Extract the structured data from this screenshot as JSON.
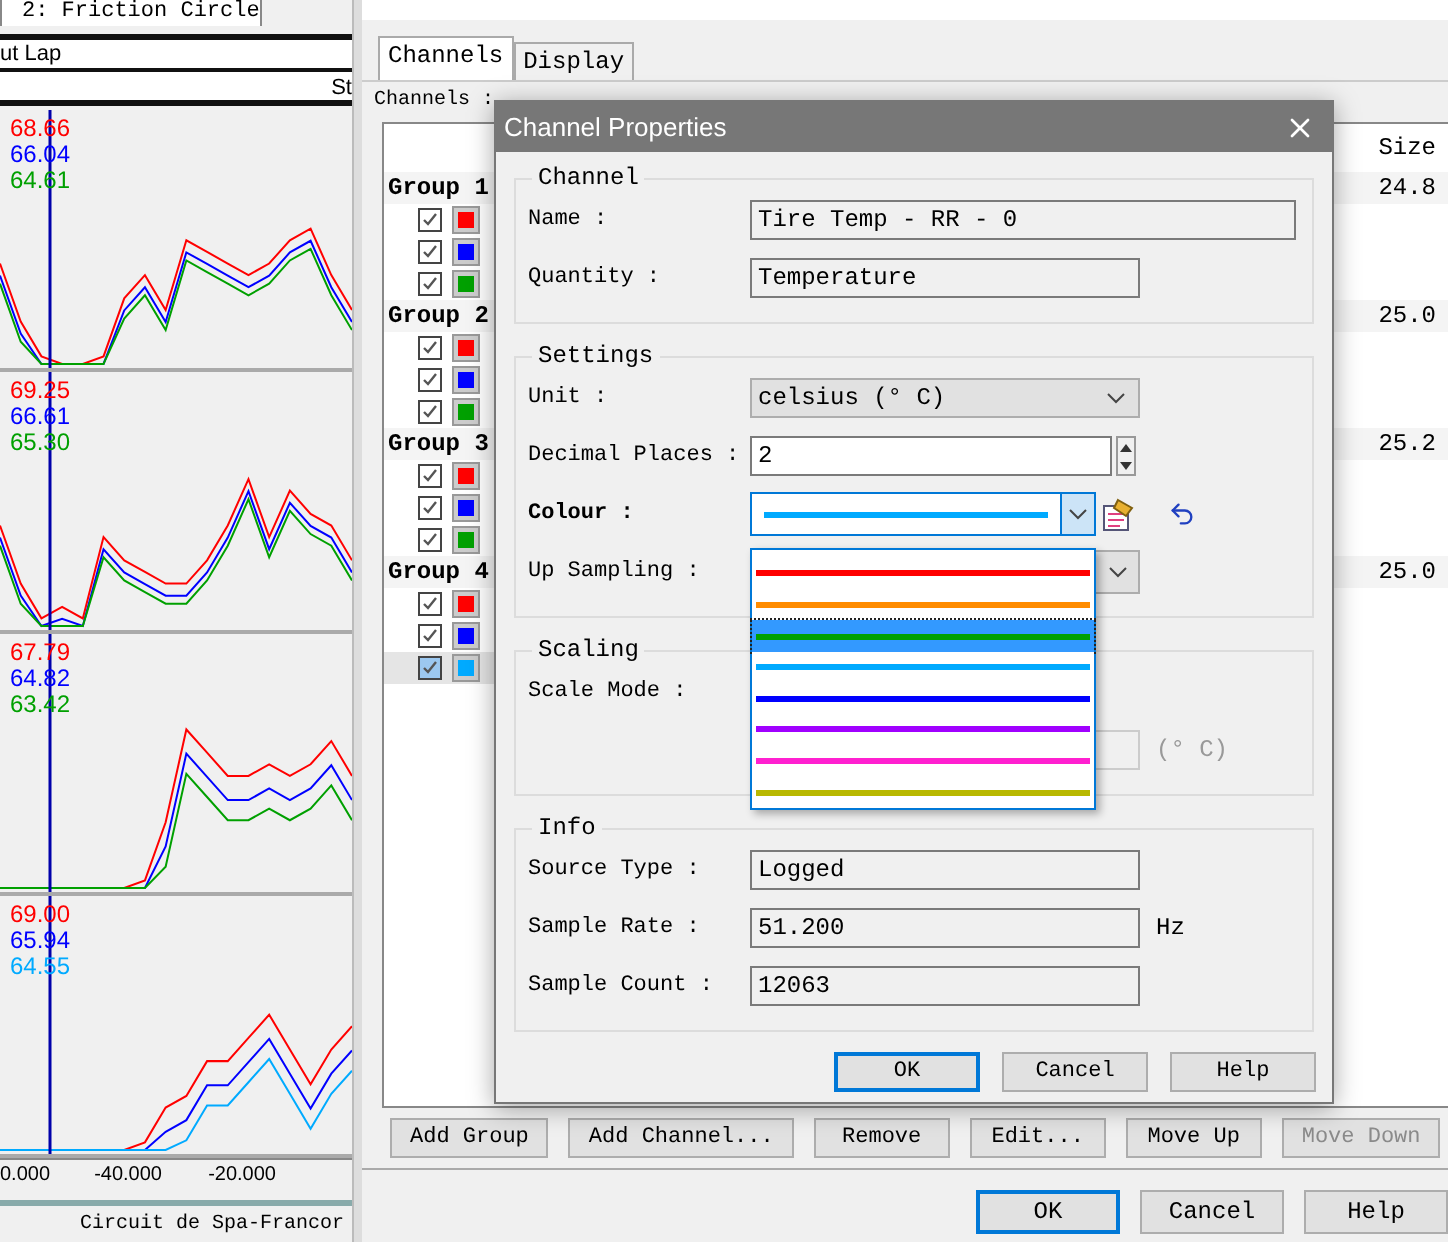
{
  "chart_window": {
    "tab": "2: Friction Circle",
    "header_1": "ut Lap",
    "header_2": "St",
    "panes": [
      {
        "readings": [
          {
            "value": "68.66",
            "color": "#ff0000"
          },
          {
            "value": "66.04",
            "color": "#0000ff"
          },
          {
            "value": "64.61",
            "color": "#00a000"
          }
        ]
      },
      {
        "readings": [
          {
            "value": "69.25",
            "color": "#ff0000"
          },
          {
            "value": "66.61",
            "color": "#0000ff"
          },
          {
            "value": "65.30",
            "color": "#00a000"
          }
        ]
      },
      {
        "readings": [
          {
            "value": "67.79",
            "color": "#ff0000"
          },
          {
            "value": "64.82",
            "color": "#0000ff"
          },
          {
            "value": "63.42",
            "color": "#00a000"
          }
        ]
      },
      {
        "readings": [
          {
            "value": "69.00",
            "color": "#ff0000"
          },
          {
            "value": "65.94",
            "color": "#0000ff"
          },
          {
            "value": "64.55",
            "color": "#00aaff"
          }
        ]
      }
    ],
    "x_axis_labels": [
      "0.000",
      "-40.000",
      "-20.000"
    ],
    "status": "Circuit de Spa-Francor"
  },
  "properties": {
    "tabs": [
      {
        "label": "Channels",
        "selected": true
      },
      {
        "label": "Display",
        "selected": false
      }
    ],
    "channels_label": "Channels :",
    "size_column": "Size",
    "groups": [
      {
        "name": "Group 1",
        "size": "24.8",
        "channels": [
          {
            "checked": true,
            "color": "#ff0000",
            "selected": false
          },
          {
            "checked": true,
            "color": "#0000ff",
            "selected": false
          },
          {
            "checked": true,
            "color": "#00a000",
            "selected": false
          }
        ]
      },
      {
        "name": "Group 2",
        "size": "25.0",
        "channels": [
          {
            "checked": true,
            "color": "#ff0000",
            "selected": false
          },
          {
            "checked": true,
            "color": "#0000ff",
            "selected": false
          },
          {
            "checked": true,
            "color": "#00a000",
            "selected": false
          }
        ]
      },
      {
        "name": "Group 3",
        "size": "25.2",
        "channels": [
          {
            "checked": true,
            "color": "#ff0000",
            "selected": false
          },
          {
            "checked": true,
            "color": "#0000ff",
            "selected": false
          },
          {
            "checked": true,
            "color": "#00a000",
            "selected": false
          }
        ]
      },
      {
        "name": "Group 4",
        "size": "25.0",
        "channels": [
          {
            "checked": true,
            "color": "#ff0000",
            "selected": false
          },
          {
            "checked": true,
            "color": "#0000ff",
            "selected": false
          },
          {
            "checked": true,
            "color": "#00aaff",
            "selected": true
          }
        ]
      }
    ],
    "buttons": [
      {
        "label": "Add Group",
        "disabled": false
      },
      {
        "label": "Add Channel...",
        "disabled": false
      },
      {
        "label": "Remove",
        "disabled": false
      },
      {
        "label": "Edit...",
        "disabled": false
      },
      {
        "label": "Move Up",
        "disabled": false
      },
      {
        "label": "Move Down",
        "disabled": true
      }
    ],
    "footer_buttons": [
      {
        "label": "OK",
        "focused": true
      },
      {
        "label": "Cancel",
        "focused": false
      },
      {
        "label": "Help",
        "focused": false
      }
    ]
  },
  "dialog": {
    "title": "Channel Properties",
    "sections": [
      {
        "title": "Channel",
        "fields": [
          {
            "kind": "readonly",
            "label": "Name :",
            "value": "Tire Temp - RR - 0",
            "wide": true
          },
          {
            "kind": "readonly",
            "label": "Quantity :",
            "value": "Temperature",
            "wide": false
          }
        ]
      },
      {
        "title": "Settings",
        "fields": [
          {
            "kind": "select",
            "label": "Unit :",
            "value": "celsius (° C)"
          },
          {
            "kind": "spin",
            "label": "Decimal Places :",
            "value": "2"
          },
          {
            "kind": "colour",
            "label": "Colour :",
            "color": "#00aaff"
          },
          {
            "kind": "select",
            "label": "Up Sampling :"
          }
        ]
      },
      {
        "title": "Scaling",
        "fields": [
          {
            "kind": "label",
            "label": "Scale Mode :"
          },
          {
            "kind": "disabled",
            "unit": "(° C)"
          }
        ]
      },
      {
        "title": "Info",
        "fields": [
          {
            "kind": "readonly",
            "label": "Source Type :",
            "value": "Logged",
            "wide": false
          },
          {
            "kind": "readonly",
            "label": "Sample Rate :",
            "value": "51.200",
            "unit": "Hz",
            "wide": false
          },
          {
            "kind": "readonly",
            "label": "Sample Count :",
            "value": "12063",
            "wide": false
          }
        ]
      }
    ],
    "colour_options": [
      {
        "color": "#ff0000",
        "selected": false
      },
      {
        "color": "#ff8c00",
        "selected": false
      },
      {
        "color": "#00a000",
        "selected": true
      },
      {
        "color": "#00aaff",
        "selected": false
      },
      {
        "color": "#0000ff",
        "selected": false
      },
      {
        "color": "#a000ff",
        "selected": false
      },
      {
        "color": "#ff20d0",
        "selected": false
      },
      {
        "color": "#b8b800",
        "selected": false
      }
    ],
    "buttons": [
      {
        "label": "OK",
        "focused": true
      },
      {
        "label": "Cancel",
        "focused": false
      },
      {
        "label": "Help",
        "focused": false
      }
    ]
  }
}
